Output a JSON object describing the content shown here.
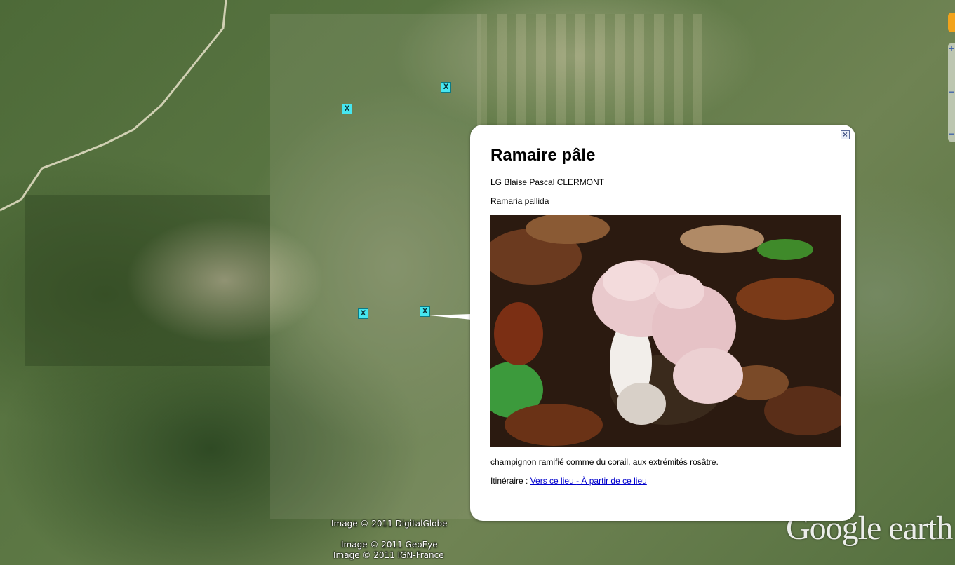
{
  "balloon": {
    "title": "Ramaire pâle",
    "location": "LG Blaise Pascal CLERMONT",
    "species": "Ramaria pallida",
    "photo_subject": "pale coral fungus among brown leaves",
    "description": "champignon ramifié comme du corail, aux extrémités rosâtre.",
    "itinerary_label": "Itinéraire : ",
    "to_here_link": "Vers ce lieu ",
    "separator": "- ",
    "from_here_link": "À partir de ce lieu",
    "close_icon": "close-icon"
  },
  "placemarks": [
    {
      "label": "X"
    },
    {
      "label": "X"
    },
    {
      "label": "X"
    },
    {
      "label": "X"
    }
  ],
  "attribution": {
    "digitalglobe": "Image © 2011 DigitalGlobe",
    "geoeye": "Image © 2011 GeoEye",
    "ign": "Image © 2011 IGN-France",
    "logo": "Google earth"
  },
  "nav": {
    "zoom_in": "+",
    "zoom_out": "−",
    "pegman_icon": "pegman-icon"
  },
  "colors": {
    "placemark": "#46e6f0",
    "link": "#0000cc",
    "balloon_bg": "#ffffff"
  }
}
